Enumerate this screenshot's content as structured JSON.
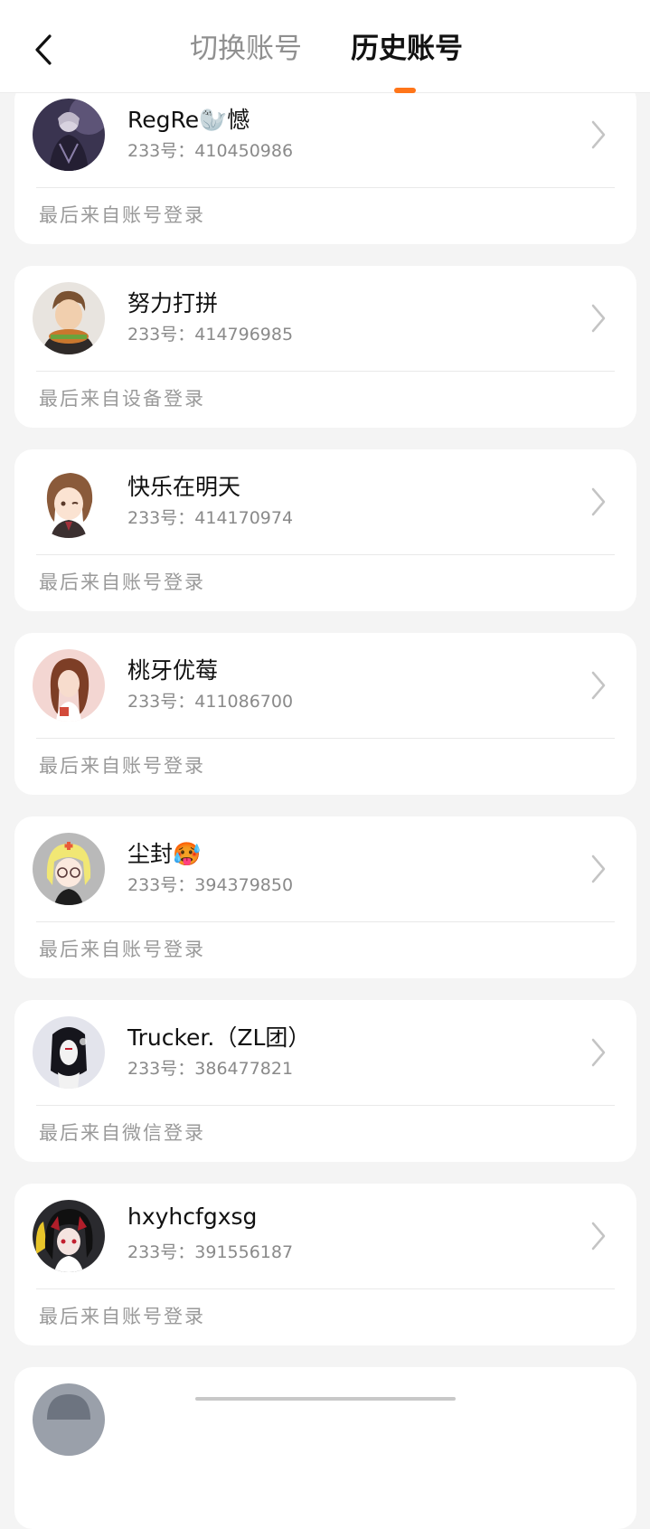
{
  "header": {
    "tab_switch": "切换账号",
    "tab_history": "历史账号",
    "accent_color": "#ff7519"
  },
  "accounts": [
    {
      "name": "RegRe🦭憾",
      "uid": "233号：410450986",
      "source": "最后来自账号登录",
      "avatar_icon": "avatar-dark-purple"
    },
    {
      "name": "努力打拼",
      "uid": "233号：414796985",
      "source": "最后来自设备登录",
      "avatar_icon": "avatar-boy-burger"
    },
    {
      "name": "快乐在明天",
      "uid": "233号：414170974",
      "source": "最后来自账号登录",
      "avatar_icon": "avatar-anime-girl-brown"
    },
    {
      "name": "桃牙优莓",
      "uid": "233号：411086700",
      "source": "最后来自账号登录",
      "avatar_icon": "avatar-girl-pink"
    },
    {
      "name": "尘封🥵",
      "uid": "233号：394379850",
      "source": "最后来自账号登录",
      "avatar_icon": "avatar-blonde-glasses"
    },
    {
      "name": "Trucker.（ZL团）",
      "uid": "233号：386477821",
      "source": "最后来自微信登录",
      "avatar_icon": "avatar-dark-figure"
    },
    {
      "name": "hxyhcfgxsg",
      "uid": "233号：391556187",
      "source": "最后来自账号登录",
      "avatar_icon": "avatar-red-black-hair"
    }
  ]
}
